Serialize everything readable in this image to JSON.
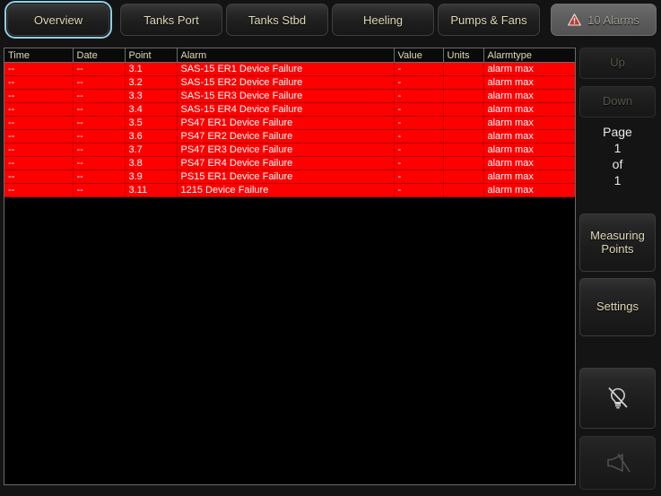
{
  "tabs": [
    {
      "id": "overview",
      "label": "Overview",
      "focused": true,
      "icon": null
    },
    {
      "id": "tanks-port",
      "label": "Tanks Port",
      "focused": false,
      "icon": null
    },
    {
      "id": "tanks-stbd",
      "label": "Tanks Stbd",
      "focused": false,
      "icon": null
    },
    {
      "id": "heeling",
      "label": "Heeling",
      "focused": false,
      "icon": null
    },
    {
      "id": "pumps-fans",
      "label": "Pumps & Fans",
      "focused": false,
      "icon": null
    },
    {
      "id": "alarms",
      "label": "10 Alarms",
      "focused": false,
      "icon": "warning-triangle-icon"
    }
  ],
  "alarm_table": {
    "columns": [
      "Time",
      "Date",
      "Point",
      "Alarm",
      "Value",
      "Units",
      "Alarmtype"
    ],
    "rows": [
      {
        "time": "--",
        "date": "--",
        "point": "3.1",
        "alarm": "SAS-15 ER1 Device Failure",
        "value": "-",
        "units": "",
        "alarmtype": "alarm max"
      },
      {
        "time": "--",
        "date": "--",
        "point": "3.2",
        "alarm": "SAS-15 ER2 Device Failure",
        "value": "-",
        "units": "",
        "alarmtype": "alarm max"
      },
      {
        "time": "--",
        "date": "--",
        "point": "3.3",
        "alarm": "SAS-15 ER3 Device Failure",
        "value": "-",
        "units": "",
        "alarmtype": "alarm max"
      },
      {
        "time": "--",
        "date": "--",
        "point": "3.4",
        "alarm": "SAS-15 ER4 Device Failure",
        "value": "-",
        "units": "",
        "alarmtype": "alarm max"
      },
      {
        "time": "--",
        "date": "--",
        "point": "3.5",
        "alarm": "PS47 ER1 Device Failure",
        "value": "-",
        "units": "",
        "alarmtype": "alarm max"
      },
      {
        "time": "--",
        "date": "--",
        "point": "3.6",
        "alarm": "PS47 ER2 Device Failure",
        "value": "-",
        "units": "",
        "alarmtype": "alarm max"
      },
      {
        "time": "--",
        "date": "--",
        "point": "3.7",
        "alarm": "PS47 ER3 Device Failure",
        "value": "-",
        "units": "",
        "alarmtype": "alarm max"
      },
      {
        "time": "--",
        "date": "--",
        "point": "3.8",
        "alarm": "PS47 ER4 Device Failure",
        "value": "-",
        "units": "",
        "alarmtype": "alarm max"
      },
      {
        "time": "--",
        "date": "--",
        "point": "3.9",
        "alarm": "PS15 ER1 Device Failure",
        "value": "-",
        "units": "",
        "alarmtype": "alarm max"
      },
      {
        "time": "--",
        "date": "--",
        "point": "3.11",
        "alarm": "1215 Device Failure",
        "value": "-",
        "units": "",
        "alarmtype": "alarm max"
      }
    ]
  },
  "sidebar": {
    "up_label": "Up",
    "down_label": "Down",
    "page": {
      "label": "Page",
      "current": "1",
      "of_label": "of",
      "total": "1"
    },
    "measuring_points_label": "Measuring\nPoints",
    "measuring_points_line1": "Measuring",
    "measuring_points_line2": "Points",
    "settings_label": "Settings",
    "lamp_icon": "lamp-off-icon",
    "horn_icon": "horn-muted-icon"
  },
  "colors": {
    "alarm_red": "#fe0000",
    "tab_text": "#ded9b6",
    "focus_ring": "#8fd0e8",
    "panel_border": "#6b6b6b",
    "background": "#141414",
    "warning_triangle": "#c0392b"
  }
}
